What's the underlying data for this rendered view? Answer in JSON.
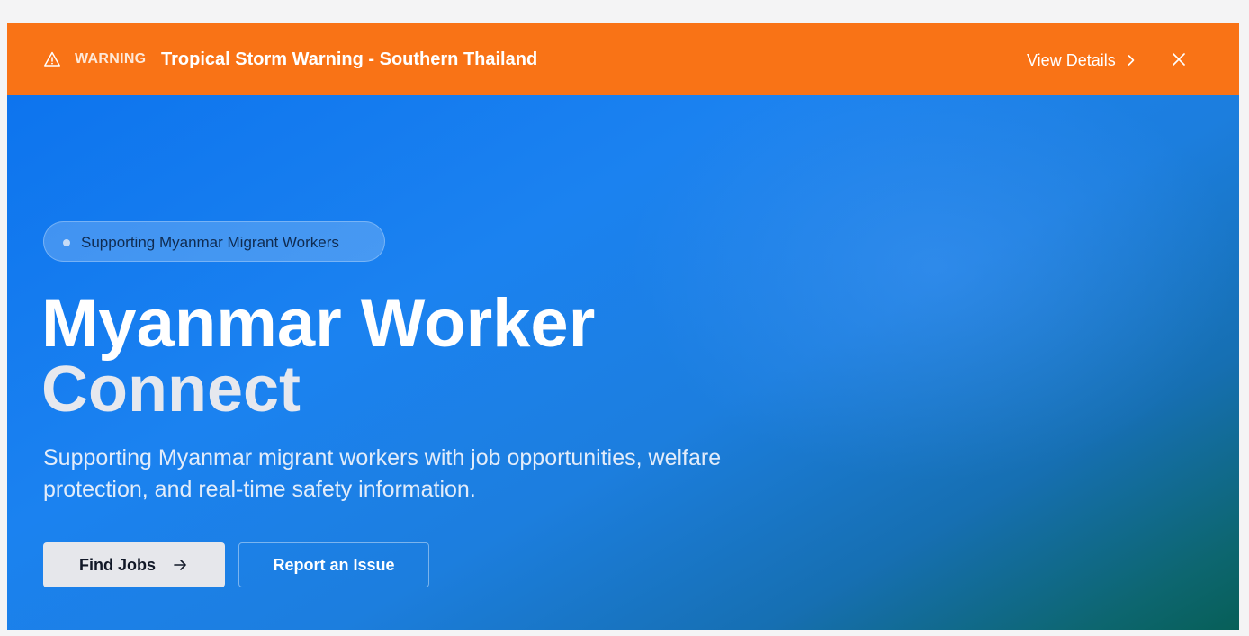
{
  "colors": {
    "page_background": "#f4f4f5",
    "alert_background": "#f97316",
    "hero_gradient_start": "#0d74ee",
    "hero_gradient_end": "#075f58",
    "primary_button": "#e6e7eb",
    "text_white": "#ffffff"
  },
  "alert": {
    "icon": "warning-triangle-icon",
    "severity": "WARNING",
    "title": "Tropical Storm Warning - Southern Thailand",
    "link_label": "View Details",
    "link_icon": "chevron-right-icon",
    "close_icon": "close-icon"
  },
  "hero": {
    "badge": {
      "icon": "dot-icon",
      "label": "Supporting Myanmar Migrant Workers"
    },
    "title_line1": "Myanmar Worker",
    "title_line2": "Connect",
    "subtitle": "Supporting Myanmar migrant workers with job opportunities, welfare protection, and real-time safety information.",
    "primary_button": {
      "label": "Find Jobs",
      "icon": "arrow-right-icon"
    },
    "secondary_button": {
      "label": "Report an Issue"
    }
  }
}
